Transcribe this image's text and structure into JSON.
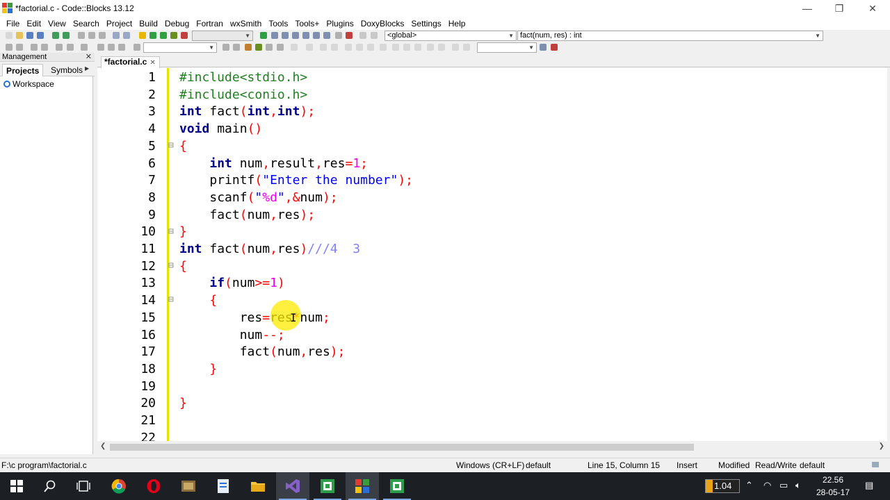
{
  "window": {
    "title": "*factorial.c - Code::Blocks 13.12",
    "minimize": "—",
    "maximize": "❐",
    "close": "✕"
  },
  "menu": [
    "File",
    "Edit",
    "View",
    "Search",
    "Project",
    "Build",
    "Debug",
    "Fortran",
    "wxSmith",
    "Tools",
    "Tools+",
    "Plugins",
    "DoxyBlocks",
    "Settings",
    "Help"
  ],
  "toolbar": {
    "scope_combo": "<global>",
    "function_combo": "fact(num, res) : int"
  },
  "management": {
    "title": "Management",
    "close": "✕",
    "tabs": [
      "Projects",
      "Symbols"
    ],
    "tree": {
      "root": "Workspace"
    }
  },
  "editor": {
    "tab_label": "*factorial.c",
    "tab_close": "✕",
    "line_numbers": [
      "1",
      "2",
      "3",
      "4",
      "5",
      "6",
      "7",
      "8",
      "9",
      "10",
      "11",
      "12",
      "13",
      "14",
      "15",
      "16",
      "17",
      "18",
      "19",
      "20",
      "21",
      "22"
    ],
    "lines": [
      "#include<stdio.h>",
      "#include<conio.h>",
      "int fact(int,int);",
      "void main()",
      "{",
      "    int num,result,res=1;",
      "    printf(\"Enter the number\");",
      "    scanf(\"%d\",&num);",
      "    fact(num,res);",
      "}",
      "int fact(num,res)///4  3",
      "{",
      "    if(num>=1)",
      "    {",
      "        res=res*num;",
      "        num--;",
      "        fact(num,res);",
      "    }",
      "",
      "}",
      "",
      ""
    ]
  },
  "statusbar": {
    "path": "F:\\c program\\factorial.c",
    "eol": "Windows (CR+LF)",
    "encoding": "default",
    "position": "Line 15, Column 15",
    "mode": "Insert",
    "state": "Modified",
    "access": "Read/Write",
    "lang": "default"
  },
  "taskbar": {
    "temp_value": "1.04",
    "time": "22.56",
    "date": "28-05-17"
  },
  "colors": {
    "keyword": "#00008b",
    "preprocessor": "#208020",
    "string": "#0000ff",
    "operator": "#ff0000",
    "number": "#f000f0",
    "comment": "#8080ff",
    "change_bar": "#e3e300",
    "taskbar": "#1c1f24"
  }
}
